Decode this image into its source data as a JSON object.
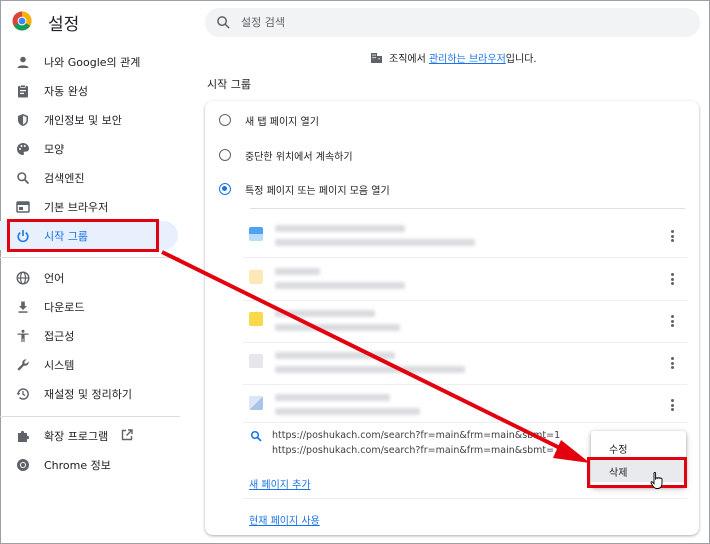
{
  "app": {
    "title": "설정"
  },
  "search": {
    "placeholder": "설정 검색"
  },
  "sidebar": {
    "items": [
      {
        "label": "나와 Google의 관계",
        "icon": "person-icon"
      },
      {
        "label": "자동 완성",
        "icon": "clipboard-icon"
      },
      {
        "label": "개인정보 및 보안",
        "icon": "shield-icon"
      },
      {
        "label": "모양",
        "icon": "palette-icon"
      },
      {
        "label": "검색엔진",
        "icon": "search-icon"
      },
      {
        "label": "기본 브라우저",
        "icon": "browser-icon"
      },
      {
        "label": "시작 그룹",
        "icon": "power-icon",
        "active": true
      },
      {
        "label": "언어",
        "icon": "globe-icon"
      },
      {
        "label": "다운로드",
        "icon": "download-icon"
      },
      {
        "label": "접근성",
        "icon": "accessibility-icon"
      },
      {
        "label": "시스템",
        "icon": "wrench-icon"
      },
      {
        "label": "재설정 및 정리하기",
        "icon": "history-icon"
      }
    ],
    "extensions_label": "확장 프로그램",
    "about_label": "Chrome 정보"
  },
  "managed": {
    "prefix": "조직에서 ",
    "link": "관리하는 브라우저",
    "suffix": "입니다."
  },
  "startup": {
    "section_title": "시작 그룹",
    "options": [
      {
        "label": "새 탭 페이지 열기",
        "checked": false
      },
      {
        "label": "중단한 위치에서 계속하기",
        "checked": false
      },
      {
        "label": "특정 페이지 또는 페이지 모음 열기",
        "checked": true
      }
    ],
    "edit_entry": {
      "line1": "https://poshukach.com/search?fr=main&frm=main&sbmt=1",
      "line2": "https://poshukach.com/search?fr=main&frm=main&sbmt=1"
    },
    "add_page_link": "새 페이지 추가",
    "use_current_link": "현재 페이지 사용"
  },
  "context_menu": {
    "edit": "수정",
    "delete": "삭제"
  },
  "colors": {
    "accent": "#1a73e8",
    "annotation": "#e3000f"
  }
}
